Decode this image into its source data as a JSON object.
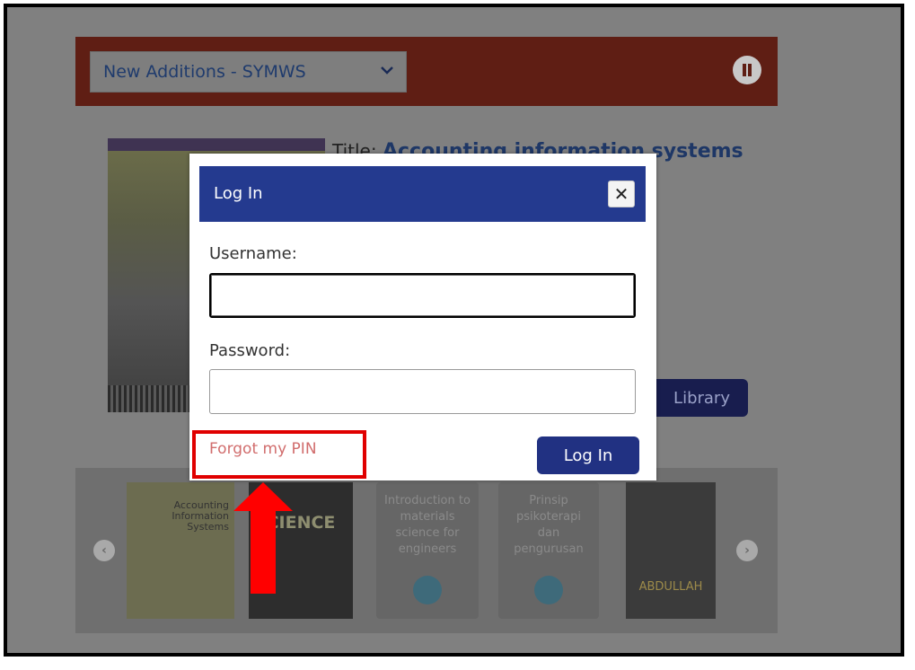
{
  "header": {
    "dropdown_value": "New Additions - SYMWS",
    "pause_icon": "pause-icon"
  },
  "featured": {
    "title_prefix": "Title:",
    "title": "Accounting information systems",
    "library_button": "Library"
  },
  "carousel": {
    "items": [
      {
        "text": "Accounting Information Systems"
      },
      {
        "text": "CIENCE"
      },
      {
        "text": "Introduction to materials science for engineers"
      },
      {
        "text": "Prinsip psikoterapi dan pengurusan"
      },
      {
        "text": "ABDULLAH"
      }
    ]
  },
  "modal": {
    "title": "Log In",
    "username_label": "Username:",
    "username_value": "",
    "password_label": "Password:",
    "password_value": "",
    "forgot_link": "Forgot my PIN",
    "login_button": "Log In"
  },
  "colors": {
    "header_bg": "#5f1e14",
    "modal_header": "#243a8f",
    "highlight": "#e00000",
    "forgot_link": "#d16d6d"
  }
}
